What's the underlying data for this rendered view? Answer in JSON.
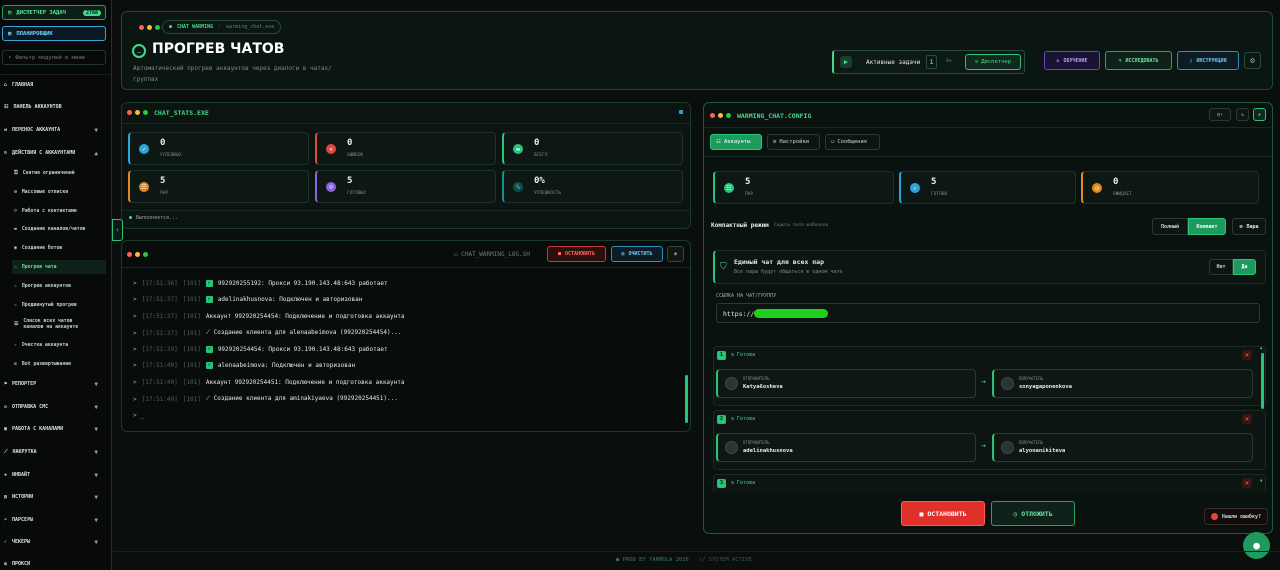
{
  "sidebar": {
    "dispatcher_label": "ДИСПЕТЧЕР ЗАДАЧ",
    "dispatcher_badge": "2788",
    "planner_label": "ПЛАНИРОВЩИК",
    "filter_placeholder": "Фильтр модулей в меню",
    "items": [
      {
        "label": "ГЛАВНАЯ"
      },
      {
        "label": "ПАНЕЛЬ АККАУНТОВ"
      },
      {
        "label": "ПЕРЕНОС АККАУНТА"
      },
      {
        "label": "ДЕЙСТВИЯ С АККАУНТАМИ"
      }
    ],
    "subitems": [
      {
        "label": "Снятие ограничений"
      },
      {
        "label": "Массовые отписки"
      },
      {
        "label": "Работа с контактами"
      },
      {
        "label": "Создание каналов/чатов"
      },
      {
        "label": "Создание ботов"
      },
      {
        "label": "Прогрев чата"
      },
      {
        "label": "Прогрев аккаунтов"
      },
      {
        "label": "Продвинутый прогрев"
      },
      {
        "label": "Список всех чатов каналов на аккаунте"
      },
      {
        "label": "Очистка аккаунта"
      },
      {
        "label": "Bot развертывание"
      }
    ],
    "bottom_items": [
      {
        "label": "РЕПОРТЕР"
      },
      {
        "label": "ОТПРАВКА СМС"
      },
      {
        "label": "РАБОТА С КАНАЛАМИ"
      },
      {
        "label": "НАКРУТКА"
      },
      {
        "label": "ИНВАЙТ"
      },
      {
        "label": "ИСТОРИИ"
      },
      {
        "label": "ПАРСЕРЫ"
      },
      {
        "label": "ЧЕКЕРЫ"
      },
      {
        "label": "ПРОКСИ"
      }
    ]
  },
  "header": {
    "pill_label": "CHAT WARMING",
    "pill_file": "warming_chat.exe",
    "title": "ПРОГРЕВ ЧАТОВ",
    "subtitle_line1": "Автоматический прогрев аккаунтов через диалоги в чатах/",
    "subtitle_line2": "группах",
    "active_tasks_label": "Активные задачи",
    "active_tasks_count": "1",
    "active_tasks_extra": "0%",
    "dispatcher_btn": "Диспетчер",
    "learn_btn": "ОБУЧЕНИЕ",
    "research_btn": "ИССЛЕДОВАТЬ",
    "instruction_btn": "ИНСТРУКЦИЯ"
  },
  "stats_panel": {
    "title": "CHAT_STATS.EXE",
    "stats": [
      {
        "value": "0",
        "label": "УСПЕШНЫХ",
        "color": "#2aa6d6"
      },
      {
        "value": "0",
        "label": "ОШИБОК",
        "color": "#e2463f"
      },
      {
        "value": "0",
        "label": "ВСЕГО",
        "color": "#27c47a"
      },
      {
        "value": "5",
        "label": "ПАР",
        "color": "#e08a1e"
      },
      {
        "value": "5",
        "label": "ГОТОВЫХ",
        "color": "#8a63e0"
      },
      {
        "value": "0%",
        "label": "УСПЕШНОСТЬ",
        "color": "#1f8c8c"
      }
    ],
    "status": "Выполняется..."
  },
  "log_panel": {
    "title": "CHAT_WARMING_LOG.SH",
    "stop_btn": "ОСТАНОВИТЬ",
    "clear_btn": "ОЧИСТИТЬ",
    "lines": [
      {
        "time": "[17:51:36]",
        "tag": "[101]",
        "check": true,
        "text": "992920255192: Прокси 93.190.143.48:643 работает"
      },
      {
        "time": "[17:51:37]",
        "tag": "[101]",
        "check": true,
        "text": "adelinakhusnova: Подключен и авторизован"
      },
      {
        "time": "[17:51:37]",
        "tag": "[101]",
        "check": false,
        "text": "Аккаунт 992920254454: Подключение и подготовка аккаунта"
      },
      {
        "time": "[17:51:37]",
        "tag": "[101]",
        "check": false,
        "text": "⟋ Создание клиента для alenaabeimova (992920254454)..."
      },
      {
        "time": "[17:51:39]",
        "tag": "[101]",
        "check": true,
        "text": "992920254454: Прокси 93.190.143.48:643 работает"
      },
      {
        "time": "[17:51:40]",
        "tag": "[101]",
        "check": true,
        "text": "alenaabeimova: Подключен и авторизован"
      },
      {
        "time": "[17:51:40]",
        "tag": "[101]",
        "check": false,
        "text": "Аккаунт 992920254451: Подключение и подготовка аккаунта"
      },
      {
        "time": "[17:51:40]",
        "tag": "[101]",
        "check": false,
        "text": "⟋ Создание клиента для aminakiyaeva (992920254451)..."
      }
    ],
    "prompt": "> _"
  },
  "config_panel": {
    "title": "WARMING_CHAT.CONFIG",
    "tabs": [
      {
        "label": "Аккаунты"
      },
      {
        "label": "Настройки"
      },
      {
        "label": "Сообщения"
      }
    ],
    "stats": [
      {
        "value": "5",
        "label": "ПАР",
        "color": "#27c47a"
      },
      {
        "value": "5",
        "label": "ГОТОВО",
        "color": "#2aa6d6"
      },
      {
        "value": "0",
        "label": "ОЖИДАЕТ",
        "color": "#e08a1e"
      }
    ],
    "compact_label": "Компактный режим",
    "compact_hint": "Скрыть поля шаблонов",
    "mode_full": "Полный",
    "mode_compact": "Компакт",
    "pairs_btn": "Пара",
    "single_chat_title": "Единый чат для всех пар",
    "single_chat_desc": "Все пары будут общаться в одном чате",
    "no_label": "Нет",
    "yes_label": "Да",
    "link_label": "ССЫЛКА НА ЧАТ/ГРУППУ",
    "link_value": "https://",
    "pairs": [
      {
        "num": "1",
        "status": "Готова",
        "sender_label": "ОТПРАВИТЕЛЬ",
        "sender": "Katya6osheva",
        "receiver_label": "ПОЛУЧАТЕЛЬ",
        "receiver": "sonyagaponenkova"
      },
      {
        "num": "2",
        "status": "Готова",
        "sender_label": "ОТПРАВИТЕЛЬ",
        "sender": "adelinakhusnova",
        "receiver_label": "ПОЛУЧАТЕЛЬ",
        "receiver": "alyonanikiteva"
      },
      {
        "num": "3",
        "status": "Готова"
      }
    ],
    "stop_btn": "ОСТАНОВИТЬ",
    "postpone_btn": "ОТЛОЖИТЬ"
  },
  "bug_btn": "Нашли ошибку?",
  "footer": {
    "left": "● PROD BY YARMOLA 2026",
    "right": "// SYSTEM ACTIVE"
  }
}
